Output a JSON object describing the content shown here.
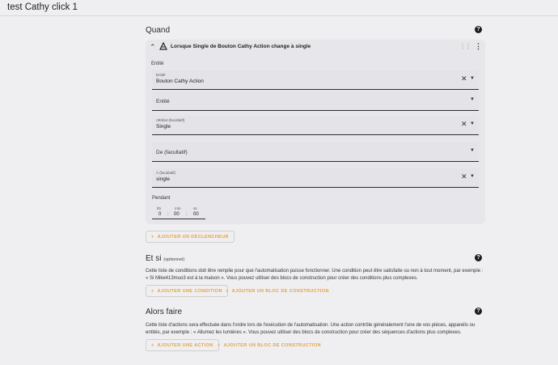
{
  "header": {
    "title": "test Cathy click 1"
  },
  "quand": {
    "title": "Quand",
    "help_icon": "help-circle-icon",
    "trigger": {
      "title": "Lorsque Single de Bouton Cathy Action change à single",
      "icon": "state-change-icon",
      "section_label": "Entité",
      "fields": [
        {
          "label": "Entité",
          "value": "Bouton Cathy Action"
        },
        {
          "label": "Entité",
          "value": ""
        },
        {
          "label": "Attribut (facultatif)",
          "value": "Single"
        },
        {
          "label": "De (facultatif)",
          "value": ""
        },
        {
          "label": "À (facultatif)",
          "value": "single"
        }
      ],
      "duration": {
        "label": "Pendant",
        "units": [
          "hh",
          "mm",
          "ss"
        ],
        "values": [
          "0",
          "00",
          "00"
        ]
      }
    },
    "add_button": "AJOUTER UN DÉCLENCHEUR"
  },
  "et_si": {
    "title": "Et si",
    "optional": "(optionnel)",
    "description": "Cette liste de conditions doit être remplie pour que l'automatisation puisse fonctionner. Une condition peut être satisfaite ou non à tout moment, par exemple : « Si Mike413muo3 est à la maison ». Vous pouvez utiliser des blocs de construction pour créer des conditions plus complexes.",
    "add_button": "AJOUTER UNE CONDITION",
    "block_button": "AJOUTER UN BLOC DE CONSTRUCTION"
  },
  "alors": {
    "title": "Alors faire",
    "description": "Cette liste d'actions sera effectuée dans l'ordre lors de l'exécution de l'automatisation. Une action contrôle généralement l'une de vos pièces, appareils ou entités, par exemple : « Allumez les lumières ». Vous pouvez utiliser des blocs de construction pour créer des séquences d'actions plus complexes.",
    "add_button": "AJOUTER UNE ACTION",
    "block_button": "AJOUTER UN BLOC DE CONSTRUCTION"
  },
  "colors": {
    "accent": "#e8a33d",
    "background": "#efeef1",
    "card": "#e7e6ea"
  }
}
